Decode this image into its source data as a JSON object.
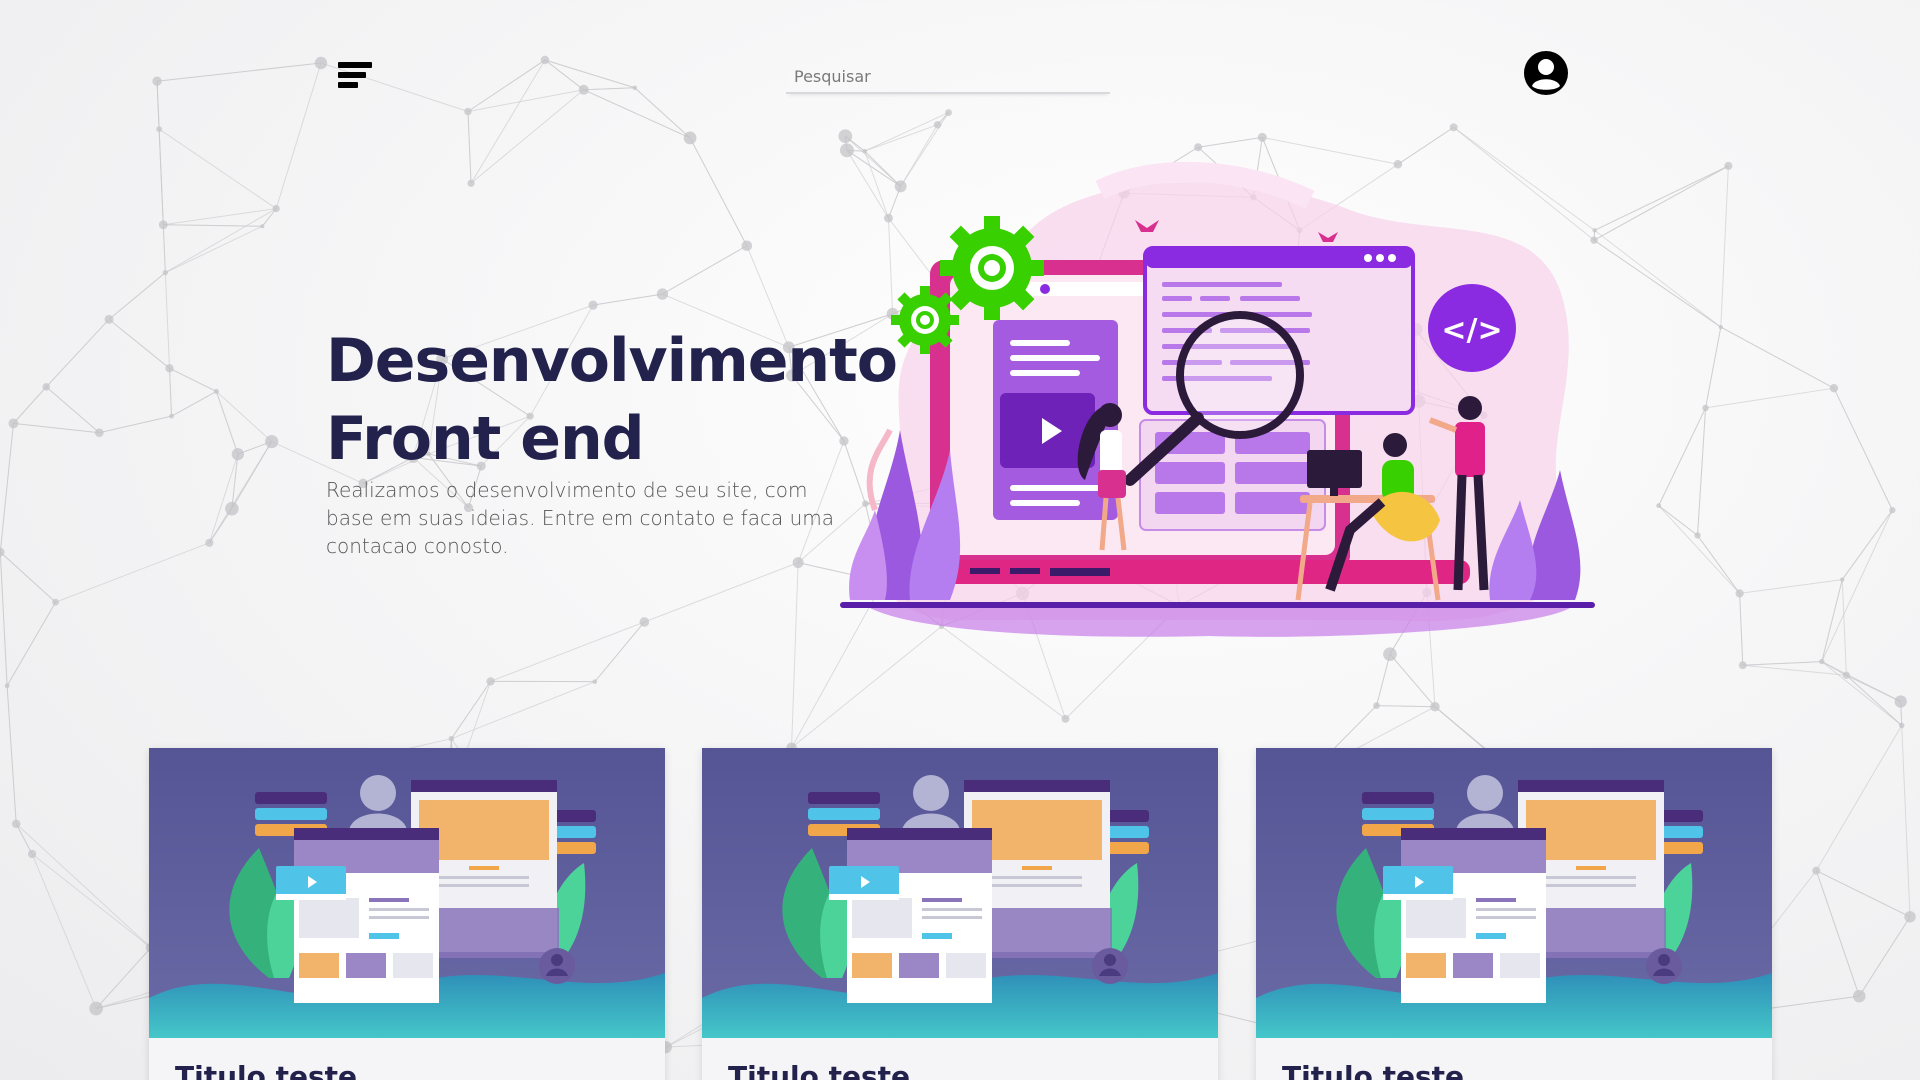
{
  "header": {
    "menu_icon": "hamburger-menu-icon",
    "search_placeholder": "Pesquisar",
    "search_value": "",
    "user_icon": "user-account-icon"
  },
  "hero": {
    "title_line1": "Desenvolvimento",
    "title_line2": "Front end",
    "description": "Realizamos o desenvolvimento de seu site, com base em suas ideias. Entre em contato e faca uma contacao conosto.",
    "illustration": {
      "code_badge": "</>",
      "icon": "web-development-illustration"
    }
  },
  "cards": [
    {
      "title": "Titulo teste",
      "image": "web-layout-illustration"
    },
    {
      "title": "Titulo teste",
      "image": "web-layout-illustration"
    },
    {
      "title": "Titulo teste",
      "image": "web-layout-illustration"
    }
  ],
  "colors": {
    "title": "#22224d",
    "card_bg": "#5b5b9a",
    "accent_purple": "#8a2be2",
    "accent_pink": "#e0218a",
    "accent_green": "#39d000",
    "wave_teal": "#37b7c9"
  }
}
